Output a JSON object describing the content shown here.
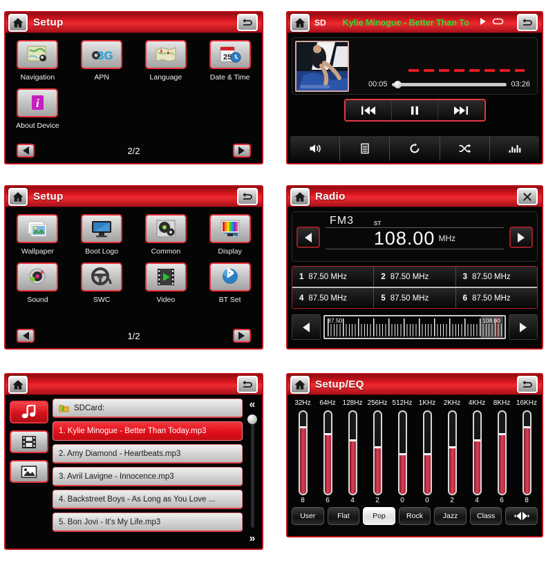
{
  "panels": {
    "setup2": {
      "title": "Setup",
      "home_icon": "home-icon",
      "back_icon": "back-arrow-icon",
      "page_indicator": "2/2",
      "prev_label": "prev-page",
      "next_label": "next-page",
      "items": [
        {
          "label": "Navigation",
          "icon": "navigation-map-icon"
        },
        {
          "label": "APN",
          "icon": "3g-apn-icon"
        },
        {
          "label": "Language",
          "icon": "language-map-icon"
        },
        {
          "label": "Date & Time",
          "icon": "calendar-clock-icon"
        },
        {
          "label": "About Device",
          "icon": "info-icon"
        }
      ]
    },
    "media": {
      "source": "SD",
      "track_title": "Kylie Minogue - Better Than To",
      "play_state_icon": "play-icon",
      "repeat_icon": "repeat-icon",
      "back_icon": "back-arrow-icon",
      "elapsed": "00:05",
      "duration": "03:26",
      "progress_percent": 2,
      "transport": [
        {
          "name": "previous-track",
          "glyph": "⏮"
        },
        {
          "name": "pause",
          "glyph": "⏸"
        },
        {
          "name": "next-track",
          "glyph": "⏭"
        }
      ],
      "toolbar": [
        {
          "name": "volume-icon"
        },
        {
          "name": "playlist-icon"
        },
        {
          "name": "repeat-icon"
        },
        {
          "name": "shuffle-icon"
        },
        {
          "name": "equalizer-icon"
        }
      ]
    },
    "setup1": {
      "title": "Setup",
      "page_indicator": "1/2",
      "items": [
        {
          "label": "Wallpaper",
          "icon": "wallpaper-icon"
        },
        {
          "label": "Boot Logo",
          "icon": "monitor-icon"
        },
        {
          "label": "Common",
          "icon": "gear-settings-icon"
        },
        {
          "label": "Display",
          "icon": "display-color-icon"
        },
        {
          "label": "Sound",
          "icon": "sound-icon"
        },
        {
          "label": "SWC",
          "icon": "steering-wheel-icon"
        },
        {
          "label": "Video",
          "icon": "video-film-icon"
        },
        {
          "label": "BT Set",
          "icon": "bluetooth-icon"
        }
      ]
    },
    "radio": {
      "title": "Radio",
      "close_icon": "close-icon",
      "band": "FM3",
      "stereo_indicator": "ST",
      "frequency": "108.00",
      "unit": "MHz",
      "tune_down": "tune-down",
      "tune_up": "tune-up",
      "presets": [
        {
          "index": "1",
          "freq": "87.50 MHz"
        },
        {
          "index": "2",
          "freq": "87.50 MHz"
        },
        {
          "index": "3",
          "freq": "87.50 MHz"
        },
        {
          "index": "4",
          "freq": "87.50 MHz"
        },
        {
          "index": "5",
          "freq": "87.50 MHz"
        },
        {
          "index": "6",
          "freq": "87.50 MHz"
        }
      ],
      "scale_min": "87.50",
      "scale_max": "108.00"
    },
    "browser": {
      "back_icon": "back-arrow-icon",
      "sources": [
        {
          "name": "music-tab",
          "icon": "music-note-icon",
          "active": true
        },
        {
          "name": "video-tab",
          "icon": "film-icon",
          "active": false
        },
        {
          "name": "photo-tab",
          "icon": "photo-icon",
          "active": false
        }
      ],
      "path_label": "SDCard:",
      "path_icon": "folder-sd-icon",
      "files": [
        {
          "text": "1.  Kylie Minogue - Better Than Today.mp3",
          "selected": true
        },
        {
          "text": "2.  Amy Diamond - Heartbeats.mp3",
          "selected": false
        },
        {
          "text": "3.  Avril Lavigne - Innocence.mp3",
          "selected": false
        },
        {
          "text": "4.  Backstreet Boys - As Long as You Love ...",
          "selected": false
        },
        {
          "text": "5.  Bon Jovi - It's My Life.mp3",
          "selected": false
        }
      ],
      "scroll_up": "«",
      "scroll_down": "»"
    },
    "eq": {
      "title": "Setup/EQ",
      "back_icon": "back-arrow-icon",
      "bands": [
        "32Hz",
        "64Hz",
        "128Hz",
        "256Hz",
        "512Hz",
        "1KHz",
        "2KHz",
        "4KHz",
        "8KHz",
        "16KHz"
      ],
      "values": [
        8,
        6,
        4,
        2,
        0,
        0,
        2,
        4,
        6,
        8
      ],
      "fill_percent": [
        82,
        74,
        66,
        58,
        50,
        50,
        58,
        66,
        74,
        82
      ],
      "presets": [
        {
          "label": "User",
          "active": false
        },
        {
          "label": "Flat",
          "active": false
        },
        {
          "label": "Pop",
          "active": true
        },
        {
          "label": "Rock",
          "active": false
        },
        {
          "label": "Jazz",
          "active": false
        },
        {
          "label": "Class",
          "active": false
        }
      ],
      "mute_icon": "mute-icon"
    }
  },
  "colors": {
    "accent_red": "#d4161e",
    "panel_bg": "#050505",
    "title_green": "#2ee02e",
    "selected_row": "#e0101a"
  }
}
